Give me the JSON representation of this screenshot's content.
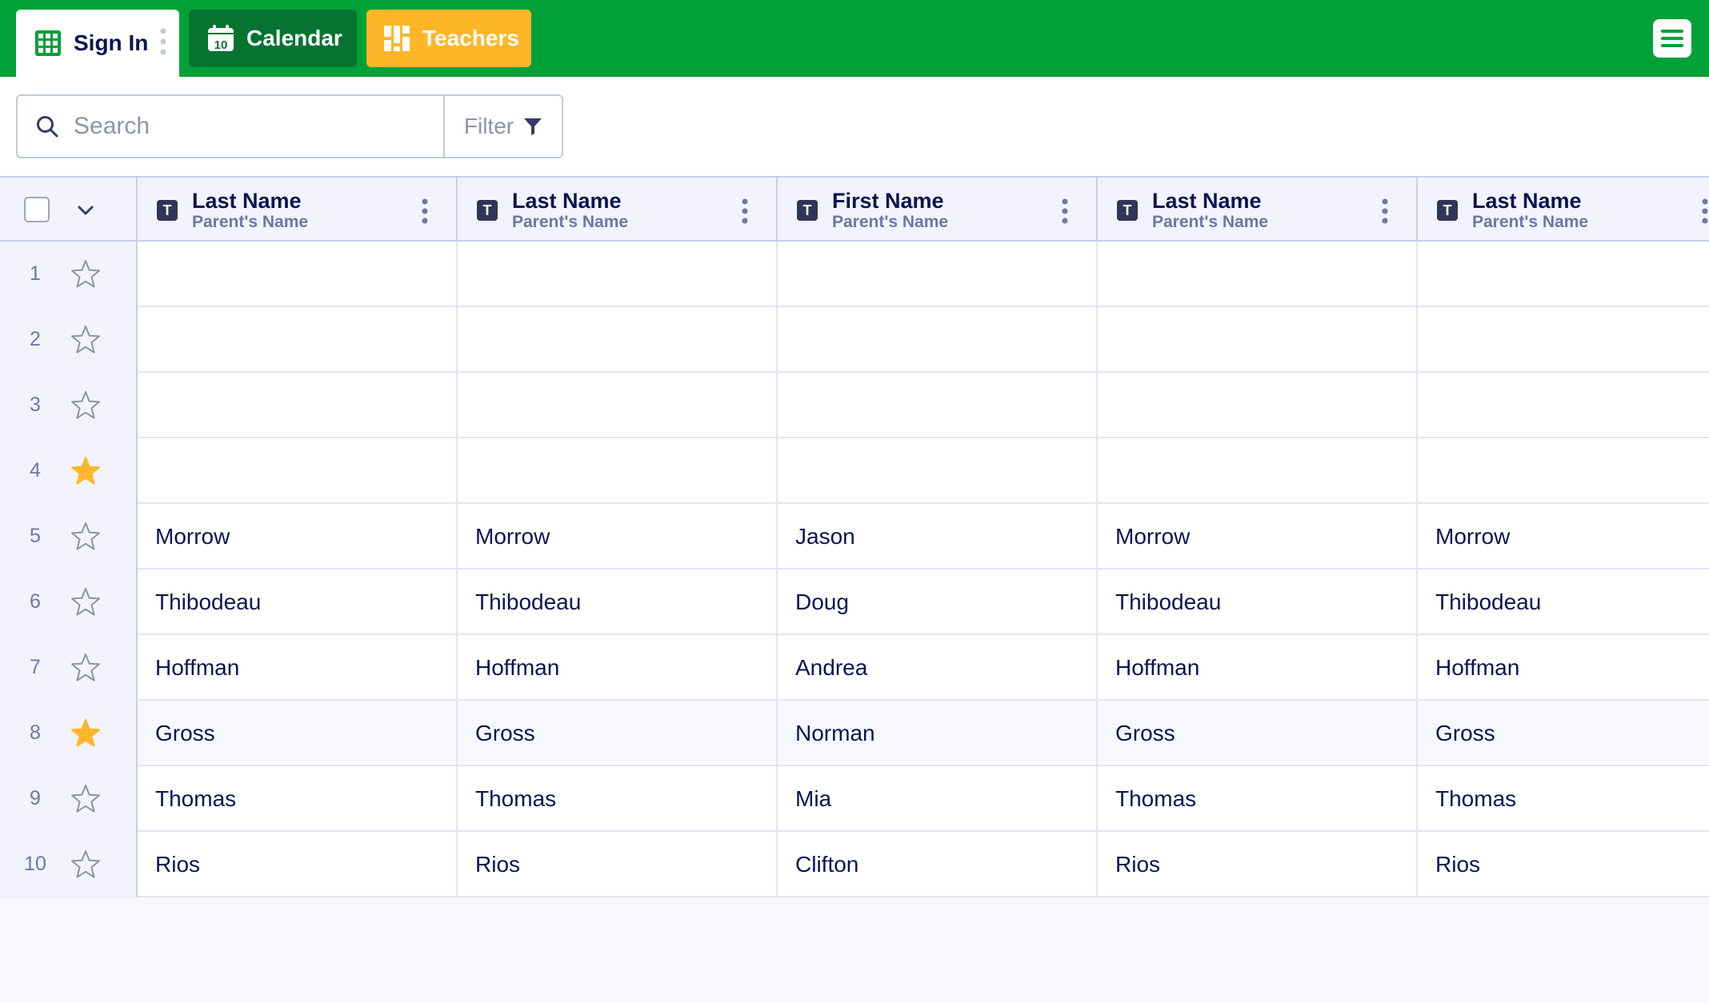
{
  "tabs": [
    {
      "label": "Sign In",
      "active": true
    },
    {
      "label": "Calendar",
      "active": false
    },
    {
      "label": "Teachers",
      "active": false
    }
  ],
  "calendar_icon_number": "10",
  "colors": {
    "topbar": "#01a13a",
    "calendar_tab": "#077330",
    "teachers_tab": "#ffb629",
    "star_filled": "#ffb629"
  },
  "search": {
    "placeholder": "Search",
    "value": ""
  },
  "filter": {
    "label": "Filter"
  },
  "columns": [
    {
      "type_badge": "T",
      "title": "Last Name",
      "subtitle": "Parent's Name"
    },
    {
      "type_badge": "T",
      "title": "Last Name",
      "subtitle": "Parent's Name"
    },
    {
      "type_badge": "T",
      "title": "First Name",
      "subtitle": "Parent's Name"
    },
    {
      "type_badge": "T",
      "title": "Last Name",
      "subtitle": "Parent's Name"
    },
    {
      "type_badge": "T",
      "title": "Last Name",
      "subtitle": "Parent's Name"
    }
  ],
  "rows": [
    {
      "num": "1",
      "starred": false,
      "cells": [
        "",
        "",
        "",
        "",
        ""
      ]
    },
    {
      "num": "2",
      "starred": false,
      "cells": [
        "",
        "",
        "",
        "",
        ""
      ]
    },
    {
      "num": "3",
      "starred": false,
      "cells": [
        "",
        "",
        "",
        "",
        ""
      ]
    },
    {
      "num": "4",
      "starred": true,
      "cells": [
        "",
        "",
        "",
        "",
        ""
      ]
    },
    {
      "num": "5",
      "starred": false,
      "cells": [
        "Morrow",
        "Morrow",
        "Jason",
        "Morrow",
        "Morrow"
      ]
    },
    {
      "num": "6",
      "starred": false,
      "cells": [
        "Thibodeau",
        "Thibodeau",
        "Doug",
        "Thibodeau",
        "Thibodeau"
      ]
    },
    {
      "num": "7",
      "starred": false,
      "cells": [
        "Hoffman",
        "Hoffman",
        "Andrea",
        "Hoffman",
        "Hoffman"
      ]
    },
    {
      "num": "8",
      "starred": true,
      "cells": [
        "Gross",
        "Gross",
        "Norman",
        "Gross",
        "Gross"
      ]
    },
    {
      "num": "9",
      "starred": false,
      "cells": [
        "Thomas",
        "Thomas",
        "Mia",
        "Thomas",
        "Thomas"
      ]
    },
    {
      "num": "10",
      "starred": false,
      "cells": [
        "Rios",
        "Rios",
        "Clifton",
        "Rios",
        "Rios"
      ]
    }
  ]
}
